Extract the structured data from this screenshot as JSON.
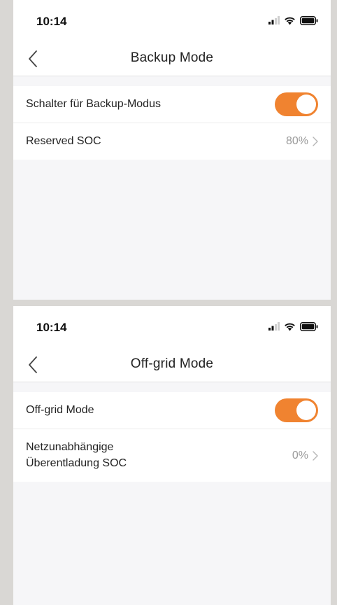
{
  "colors": {
    "accent": "#f08330"
  },
  "screens": [
    {
      "status": {
        "time": "10:14"
      },
      "nav": {
        "title": "Backup Mode"
      },
      "rows": [
        {
          "label": "Schalter für Backup-Modus",
          "toggle_on": true
        },
        {
          "label": "Reserved SOC",
          "value": "80%"
        }
      ]
    },
    {
      "status": {
        "time": "10:14"
      },
      "nav": {
        "title": "Off-grid Mode"
      },
      "rows": [
        {
          "label": "Off-grid Mode",
          "toggle_on": true
        },
        {
          "label_line1": "Netzunabhängige",
          "label_line2": "Überentladung SOC",
          "value": "0%"
        }
      ]
    }
  ]
}
